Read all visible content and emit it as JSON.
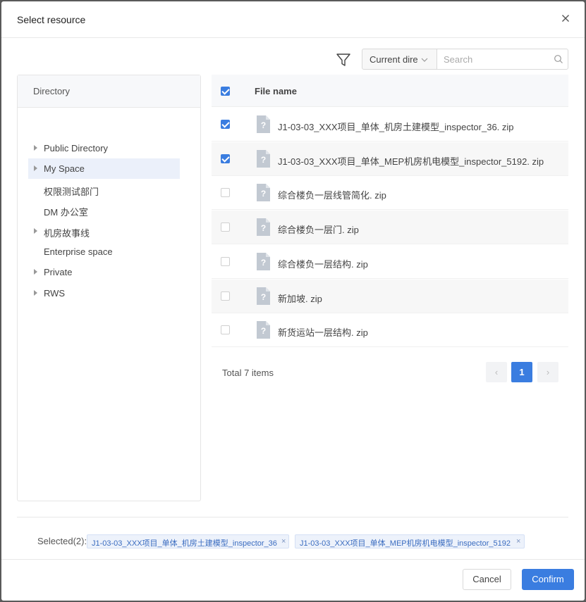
{
  "dialog": {
    "title": "Select resource"
  },
  "toolbar": {
    "scope_value": "Current dire",
    "search_placeholder": "Search"
  },
  "directory": {
    "header": "Directory",
    "items": [
      {
        "label": "Public Directory",
        "expandable": true,
        "selected": false
      },
      {
        "label": "My Space",
        "expandable": true,
        "selected": true
      },
      {
        "label": "权限测试部门",
        "expandable": false,
        "selected": false
      },
      {
        "label": "DM 办公室",
        "expandable": false,
        "selected": false
      },
      {
        "label": "机房故事线",
        "expandable": true,
        "selected": false
      },
      {
        "label": "Enterprise space",
        "expandable": false,
        "selected": false
      },
      {
        "label": "Private",
        "expandable": true,
        "selected": false
      },
      {
        "label": "RWS",
        "expandable": true,
        "selected": false
      }
    ]
  },
  "files": {
    "column_header": "File name",
    "rows": [
      {
        "name": "J1-03-03_XXX项目_单体_机房土建模型_inspector_36. zip",
        "checked": true
      },
      {
        "name": "J1-03-03_XXX项目_单体_MEP机房机电模型_inspector_5192. zip",
        "checked": true
      },
      {
        "name": "综合楼负一层线管简化. zip",
        "checked": false
      },
      {
        "name": "综合楼负一层门. zip",
        "checked": false
      },
      {
        "name": "综合楼负一层结构. zip",
        "checked": false
      },
      {
        "name": "新加坡. zip",
        "checked": false
      },
      {
        "name": "新货运站一层结构. zip",
        "checked": false
      }
    ]
  },
  "pagination": {
    "total_text": "Total 7 items",
    "current_page": "1",
    "prev_glyph": "‹",
    "next_glyph": "›"
  },
  "selection": {
    "label": "Selected(2):",
    "tags": [
      "J1-03-03_XXX项目_单体_机房土建模型_inspector_36",
      "J1-03-03_XXX项目_单体_MEP机房机电模型_inspector_5192"
    ],
    "remove_glyph": "×"
  },
  "footer": {
    "cancel_label": "Cancel",
    "confirm_label": "Confirm"
  },
  "colors": {
    "accent": "#3a7de0",
    "selected_tree_bg": "#ebf0fa",
    "tag_bg": "#edf2fb"
  },
  "icons": [
    "close-icon",
    "filter-icon",
    "chevron-down-icon",
    "search-icon",
    "caret-right-icon",
    "unknown-file-icon"
  ]
}
